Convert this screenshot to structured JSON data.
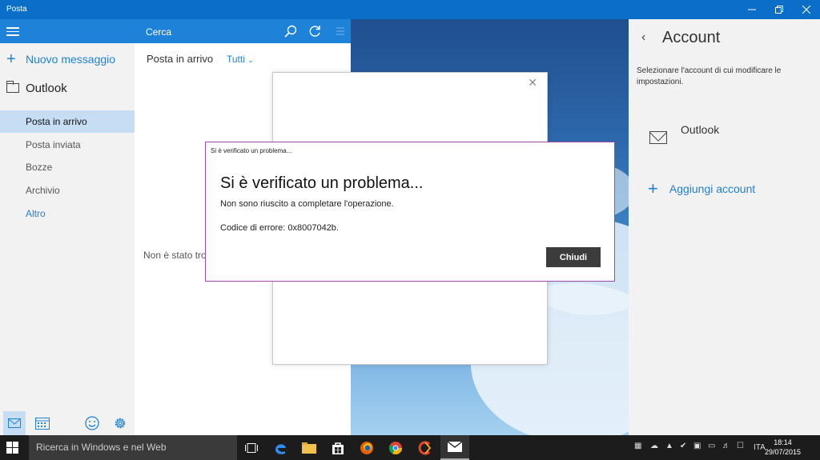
{
  "window": {
    "title": "Posta",
    "controls": [
      "minimize-icon",
      "restore-icon",
      "close-icon"
    ]
  },
  "sidebar": {
    "new_message": "Nuovo messaggio",
    "account_name": "Outlook",
    "folders": [
      {
        "label": "Posta in arrivo",
        "selected": true
      },
      {
        "label": "Posta inviata"
      },
      {
        "label": "Bozze"
      },
      {
        "label": "Archivio"
      },
      {
        "label": "Altro"
      }
    ],
    "bottom_icons": [
      "mail-icon",
      "calendar-icon",
      "smiley-icon",
      "gear-icon"
    ]
  },
  "list": {
    "search_label": "Cerca",
    "folder_title": "Posta in arrivo",
    "filter": "Tutti",
    "empty_text": "Non è stato trov"
  },
  "account_panel": {
    "back_icon": "back-arrow-icon",
    "title": "Account",
    "description": "Selezionare l'account di cui modificare le impostazioni.",
    "accounts": [
      {
        "name": "Outlook",
        "icon": "mail-icon"
      }
    ],
    "add_account": "Aggiungi account"
  },
  "error_dialog": {
    "caption": "Si è verificato un problema...",
    "heading": "Si è verificato un problema...",
    "message": "Non sono riuscito a completare l'operazione.",
    "error_code": "Codice di errore: 0x8007042b.",
    "close_button": "Chiudi"
  },
  "taskbar": {
    "search_placeholder": "Ricerca in Windows e nel Web",
    "language": "ITA",
    "time": "18:14",
    "date": "29/07/2015"
  },
  "colors": {
    "accent": "#1e82d9",
    "titlebar": "#0b6ec9",
    "selection": "#c6ddf3",
    "dialog_border": "#9b4aa5",
    "taskbar": "#1c1c1c"
  }
}
